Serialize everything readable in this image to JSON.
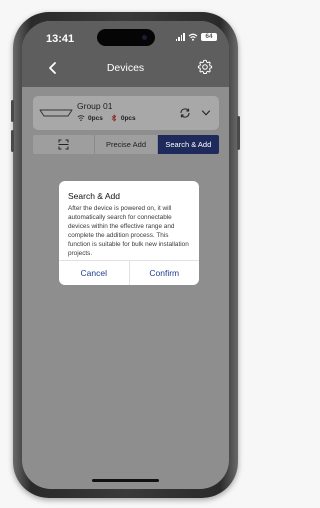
{
  "status_bar": {
    "time": "13:41",
    "battery": "64"
  },
  "nav": {
    "title": "Devices",
    "back_icon": "chevron-left-icon",
    "settings_icon": "gear-icon"
  },
  "group": {
    "name": "Group 01",
    "wifi_count": "0pcs",
    "bluetooth_count": "0pcs"
  },
  "tabs": [
    {
      "label": "",
      "icon": "scan-icon",
      "active": false
    },
    {
      "label": "Precise Add",
      "active": false
    },
    {
      "label": "Search & Add",
      "active": true
    }
  ],
  "dialog": {
    "title": "Search & Add",
    "message": "After the device is powered on, it will automatically search for connectable devices within the effective range and complete the addition process. This function is suitable for bulk new installation projects.",
    "cancel_label": "Cancel",
    "confirm_label": "Confirm"
  },
  "colors": {
    "accent": "#1e2a5c",
    "dialog_button": "#1f3d8f",
    "header": "#5e5e5e",
    "overlay": "#8e8e8e"
  }
}
